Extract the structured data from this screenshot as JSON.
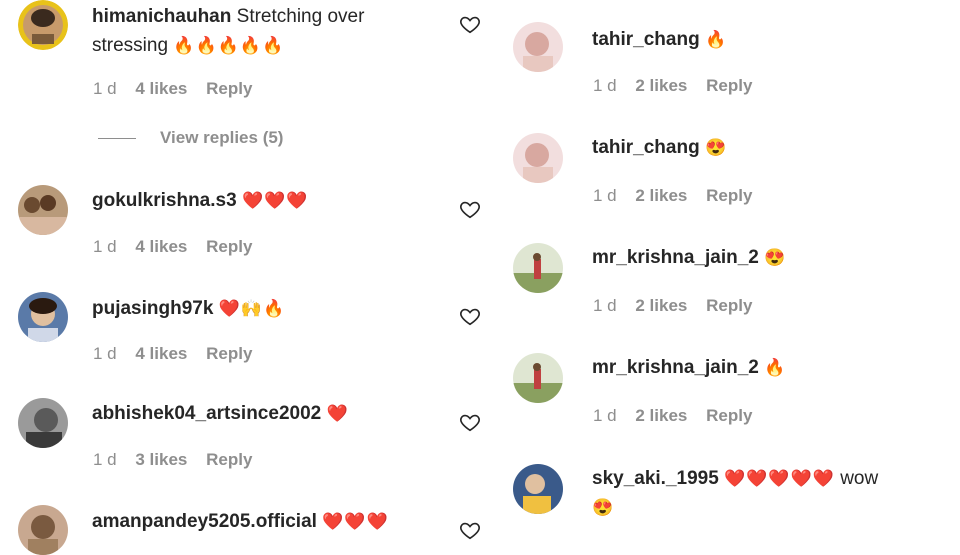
{
  "left": [
    {
      "user": "himanichauhan",
      "text": "Stretching over",
      "text2": "stressing",
      "emoji": "🔥🔥🔥🔥🔥",
      "time": "1 d",
      "likes": "4 likes",
      "reply": "Reply"
    },
    {
      "user": "gokulkrishna.s3",
      "text": "",
      "emoji": "❤️❤️❤️",
      "time": "1 d",
      "likes": "4 likes",
      "reply": "Reply"
    },
    {
      "user": "pujasingh97k",
      "text": "",
      "emoji": "❤️🙌🔥",
      "time": "1 d",
      "likes": "4 likes",
      "reply": "Reply"
    },
    {
      "user": "abhishek04_artsince2002",
      "text": "",
      "emoji": "❤️",
      "time": "1 d",
      "likes": "3 likes",
      "reply": "Reply"
    },
    {
      "user": "amanpandey5205.official",
      "text": "",
      "emoji": "❤️❤️❤️",
      "time": "",
      "likes": "",
      "reply": ""
    }
  ],
  "view_replies": "View replies (5)",
  "right": [
    {
      "user": "tahir_chang",
      "emoji": "🔥",
      "text": "",
      "time": "1 d",
      "likes": "2 likes",
      "reply": "Reply"
    },
    {
      "user": "tahir_chang",
      "emoji": "😍",
      "text": "",
      "time": "1 d",
      "likes": "2 likes",
      "reply": "Reply"
    },
    {
      "user": "mr_krishna_jain_2",
      "emoji": "😍",
      "text": "",
      "time": "1 d",
      "likes": "2 likes",
      "reply": "Reply"
    },
    {
      "user": "mr_krishna_jain_2",
      "emoji": "🔥",
      "text": "",
      "time": "1 d",
      "likes": "2 likes",
      "reply": "Reply"
    },
    {
      "user": "sky_aki._1995",
      "emoji": "❤️❤️❤️❤️❤️",
      "text": "wow",
      "emoji2": "😍",
      "time": "",
      "likes": "",
      "reply": ""
    }
  ],
  "icons": {
    "like": "heart-outline-icon"
  },
  "colors": {
    "text": "#262626",
    "meta": "#8e8e8e"
  }
}
